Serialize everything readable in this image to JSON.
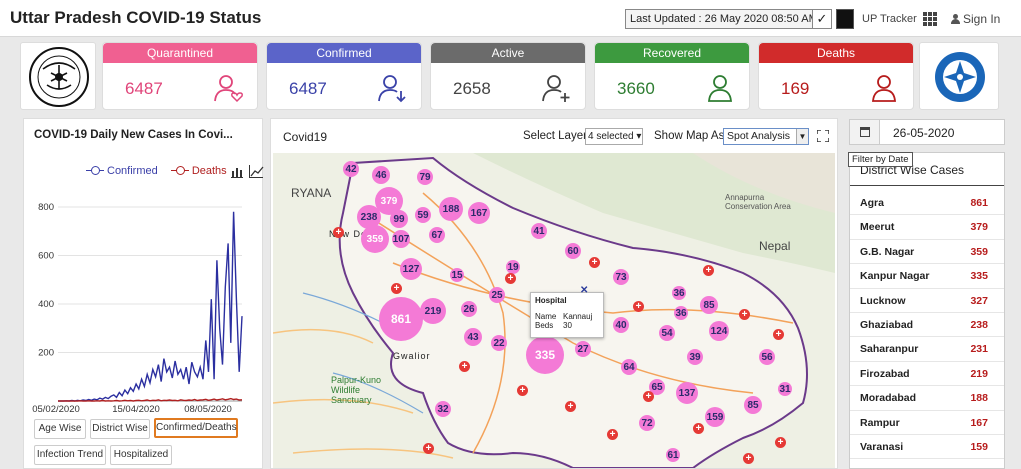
{
  "header": {
    "title": "Uttar Pradesh COVID-19 Status",
    "last_updated": "Last Updated : 26 May 2020 08:50 AM",
    "check": "✓",
    "tracker_label": "UP Tracker",
    "signin": "Sign In"
  },
  "cards": [
    {
      "label": "Quarantined",
      "value": "6487",
      "color": "#f06091",
      "icon": "person-heart-icon"
    },
    {
      "label": "Confirmed",
      "value": "6487",
      "color": "#5b64c9",
      "icon": "person-arrow-icon"
    },
    {
      "label": "Active",
      "value": "2658",
      "color": "#6b6b6b",
      "icon": "person-plus-icon"
    },
    {
      "label": "Recovered",
      "value": "3660",
      "color": "#3d9a3f",
      "icon": "person-check-icon"
    },
    {
      "label": "Deaths",
      "value": "169",
      "color": "#d12b2b",
      "icon": "person-icon"
    }
  ],
  "chart_panel": {
    "title": "COVID-19 Daily New Cases In Covi...",
    "tabs": [
      "Age Wise",
      "District Wise",
      "Confirmed/Deaths",
      "Infection Trend",
      "Hospitalized"
    ],
    "active_tab": "Confirmed/Deaths"
  },
  "chart_data": {
    "type": "line",
    "x_tick_labels": [
      "05/02/2020",
      "15/04/2020",
      "08/05/2020"
    ],
    "ylim": [
      0,
      800
    ],
    "yticks": [
      200,
      400,
      600,
      800
    ],
    "series": [
      {
        "name": "Confirmed",
        "color": "#2b2fa0",
        "values": [
          0,
          0,
          0,
          1,
          0,
          2,
          0,
          3,
          1,
          4,
          2,
          6,
          3,
          8,
          5,
          12,
          8,
          15,
          10,
          20,
          25,
          15,
          35,
          22,
          45,
          30,
          55,
          40,
          70,
          50,
          90,
          60,
          110,
          75,
          130,
          100,
          150,
          80,
          175,
          120,
          140,
          95,
          165,
          110,
          130,
          90,
          140,
          70,
          160,
          120,
          100,
          140,
          90,
          250,
          120,
          420,
          90,
          580,
          300,
          150,
          470,
          650,
          240,
          780,
          420,
          120,
          350
        ]
      },
      {
        "name": "Deaths",
        "color": "#b02020",
        "values": [
          0,
          0,
          0,
          0,
          0,
          0,
          0,
          0,
          1,
          0,
          0,
          1,
          0,
          0,
          1,
          0,
          2,
          0,
          1,
          0,
          1,
          2,
          0,
          1,
          3,
          1,
          2,
          0,
          2,
          3,
          1,
          2,
          4,
          1,
          3,
          2,
          5,
          1,
          3,
          2,
          4,
          2,
          3,
          1,
          5,
          3,
          2,
          4,
          3,
          6,
          2,
          4,
          5,
          7,
          3,
          5,
          8,
          4,
          6,
          9,
          5,
          7,
          10,
          6,
          8,
          4,
          5
        ]
      }
    ]
  },
  "map_panel": {
    "title": "Covid19",
    "layer_label": "Select Layer",
    "layer_value": "4 selected ▾",
    "map_as_label": "Show Map As",
    "map_as_value": "Spot Analysis",
    "place_labels": [
      "RYANA",
      "New Delhi",
      "Nepal",
      "Annapurna Conservation Area",
      "Gwalior",
      "Palpur-Kuno Wildlife Sanctuary"
    ],
    "circles": [
      "42",
      "46",
      "79",
      "379",
      "188",
      "167",
      "238",
      "99",
      "59",
      "359",
      "107",
      "67",
      "41",
      "60",
      "127",
      "19",
      "73",
      "15",
      "25",
      "36",
      "219",
      "861",
      "26",
      "85",
      "36",
      "124",
      "43",
      "22",
      "54",
      "40",
      "335",
      "27",
      "39",
      "56",
      "64",
      "65",
      "137",
      "159",
      "85",
      "32",
      "72",
      "31",
      "61"
    ],
    "popup": {
      "title": "Hospital",
      "name_label": "Name",
      "name_value": "Kannauj",
      "beds_label": "Beds",
      "beds_value": "30",
      "close": "✕"
    }
  },
  "right_panel": {
    "date": "26-05-2020",
    "tooltip": "Filter by Date",
    "list_title": "District Wise Cases",
    "districts": [
      {
        "name": "Agra",
        "count": "861"
      },
      {
        "name": "Meerut",
        "count": "379"
      },
      {
        "name": "G.B. Nagar",
        "count": "359"
      },
      {
        "name": "Kanpur Nagar",
        "count": "335"
      },
      {
        "name": "Lucknow",
        "count": "327"
      },
      {
        "name": "Ghaziabad",
        "count": "238"
      },
      {
        "name": "Saharanpur",
        "count": "231"
      },
      {
        "name": "Firozabad",
        "count": "219"
      },
      {
        "name": "Moradabad",
        "count": "188"
      },
      {
        "name": "Rampur",
        "count": "167"
      },
      {
        "name": "Varanasi",
        "count": "159"
      }
    ]
  }
}
